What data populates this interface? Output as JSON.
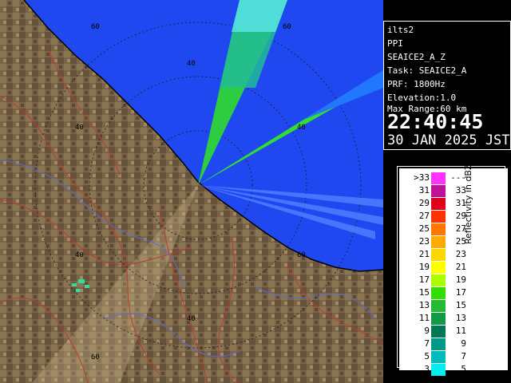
{
  "radar": {
    "site": "ilts2",
    "scan_type": "PPI",
    "product": "SEAICE2_A_Z",
    "task": "Task: SEAICE2_A",
    "prf": "PRF: 1800Hz",
    "elevation": "Elevation:1.0",
    "max_range": "Max Range:60 km",
    "time": "22:40:45",
    "date": "30 JAN 2025 JST"
  },
  "range_labels": [
    "60",
    "60",
    "40",
    "40",
    "40",
    "40",
    "40",
    "60",
    "60"
  ],
  "legend": {
    "title": "Reflectivity in dBZ",
    "rows": [
      {
        "lo": ">33",
        "hi": "---",
        "color": "#ff33ff"
      },
      {
        "lo": "31",
        "hi": "33",
        "color": "#c0109a"
      },
      {
        "lo": "29",
        "hi": "31",
        "color": "#e0001a"
      },
      {
        "lo": "27",
        "hi": "29",
        "color": "#ff3300"
      },
      {
        "lo": "25",
        "hi": "27",
        "color": "#ff7700"
      },
      {
        "lo": "23",
        "hi": "25",
        "color": "#ffaa00"
      },
      {
        "lo": "21",
        "hi": "23",
        "color": "#ffd700"
      },
      {
        "lo": "19",
        "hi": "21",
        "color": "#ffff00"
      },
      {
        "lo": "17",
        "hi": "19",
        "color": "#aaff00"
      },
      {
        "lo": "15",
        "hi": "17",
        "color": "#33dd00"
      },
      {
        "lo": "13",
        "hi": "15",
        "color": "#22bb33"
      },
      {
        "lo": "11",
        "hi": "13",
        "color": "#119944"
      },
      {
        "lo": "9",
        "hi": "11",
        "color": "#007755"
      },
      {
        "lo": "7",
        "hi": "9",
        "color": "#009988"
      },
      {
        "lo": "5",
        "hi": "7",
        "color": "#00bbbb"
      },
      {
        "lo": "3",
        "hi": "5",
        "color": "#00eeee"
      }
    ]
  },
  "colors": {
    "sea": "#1f48f0",
    "land": "#7a6548",
    "rivers": "#c0392b",
    "range_rings": "#1a1a2e",
    "panel_text": "#ffffff"
  }
}
